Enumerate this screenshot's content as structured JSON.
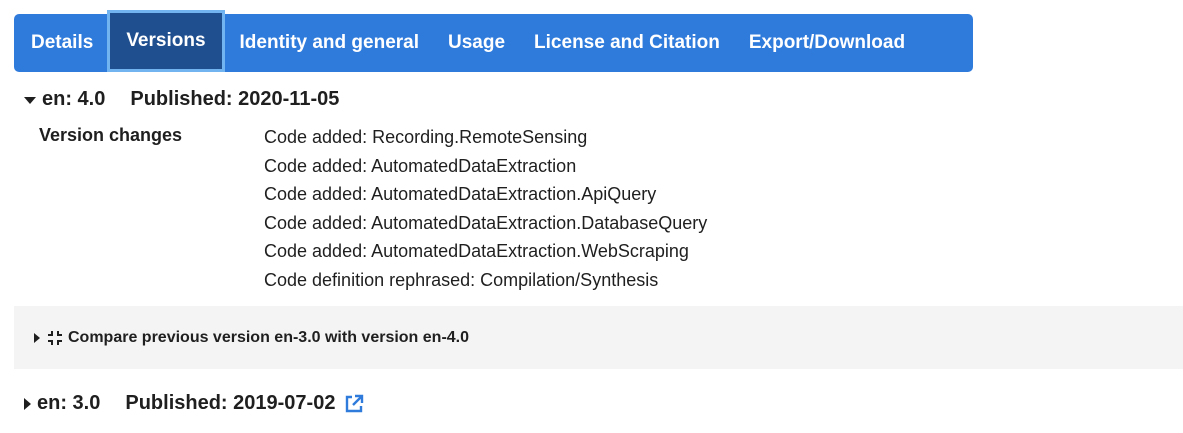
{
  "tabs": [
    {
      "label": "Details",
      "active": false
    },
    {
      "label": "Versions",
      "active": true
    },
    {
      "label": "Identity and general",
      "active": false
    },
    {
      "label": "Usage",
      "active": false
    },
    {
      "label": "License and Citation",
      "active": false
    },
    {
      "label": "Export/Download",
      "active": false
    }
  ],
  "current_version": {
    "version": "en: 4.0",
    "published": "Published: 2020-11-05",
    "changes_label": "Version changes",
    "changes": [
      "Code added: Recording.RemoteSensing",
      "Code added: AutomatedDataExtraction",
      "Code added: AutomatedDataExtraction.ApiQuery",
      "Code added: AutomatedDataExtraction.DatabaseQuery",
      "Code added: AutomatedDataExtraction.WebScraping",
      "Code definition rephrased: Compilation/Synthesis"
    ]
  },
  "compare": {
    "label": "Compare previous version en-3.0 with version en-4.0"
  },
  "previous_version": {
    "version": "en: 3.0",
    "published": "Published: 2019-07-02"
  },
  "colors": {
    "tab_bar": "#2f7bdc",
    "tab_active": "#1f4f8f",
    "link_icon": "#2f7bdc"
  },
  "icons": {
    "compare": "compress-icon",
    "external": "external-link-icon"
  }
}
